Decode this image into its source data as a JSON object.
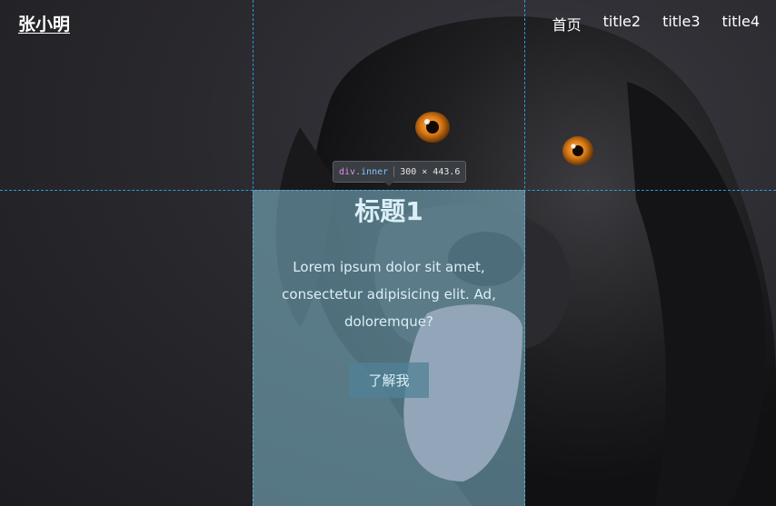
{
  "header": {
    "logo": "张小明",
    "nav": [
      "首页",
      "title2",
      "title3",
      "title4"
    ]
  },
  "panel": {
    "title": "标题1",
    "text": "Lorem ipsum dolor sit amet, consectetur adipisicing elit. Ad, doloremque?",
    "button": "了解我"
  },
  "devtools_tooltip": {
    "tag": "div",
    "class": ".inner",
    "size": "300 × 443.6"
  },
  "colors": {
    "panel_overlay": "#82bed2",
    "guide_line": "#2d9bd6",
    "text_light": "#dceff8"
  }
}
